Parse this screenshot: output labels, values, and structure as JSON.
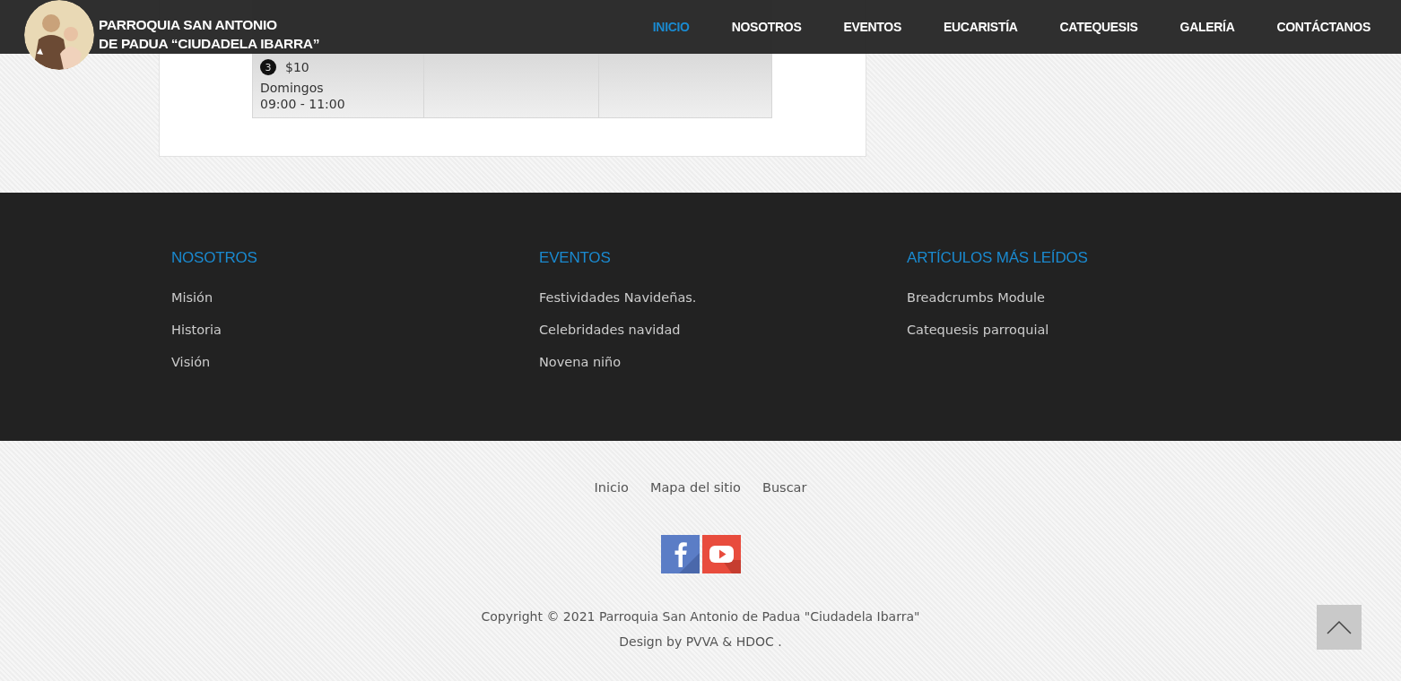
{
  "header": {
    "title_lines": [
      "PARROQUIA SAN ANTONIO",
      "DE PADUA “CIUDADELA IBARRA”"
    ],
    "nav": [
      {
        "label": "INICIO",
        "selected": true
      },
      {
        "label": "NOSOTROS",
        "selected": false
      },
      {
        "label": "EVENTOS",
        "selected": false
      },
      {
        "label": "EUCARISTÍA",
        "selected": false
      },
      {
        "label": "CATEQUESIS",
        "selected": false
      },
      {
        "label": "GALERÍA",
        "selected": false
      },
      {
        "label": "CONTÁCTANOS",
        "selected": false
      }
    ]
  },
  "schedule_card": {
    "badge": "3",
    "price": "$10",
    "day": "Domingos",
    "time": "09:00 - 11:00"
  },
  "footer_columns": [
    {
      "heading": "NOSOTROS",
      "links": [
        "Misión",
        "Historia",
        "Visión"
      ]
    },
    {
      "heading": "EVENTOS",
      "links": [
        "Festividades Navideñas.",
        "Celebridades navidad",
        "Novena niño"
      ]
    },
    {
      "heading": "ARTÍCULOS MÁS LEÍDOS",
      "links": [
        "Breadcrumbs Module",
        "Catequesis parroquial"
      ]
    }
  ],
  "bottom_links": [
    "Inicio",
    "Mapa del sitio",
    "Buscar"
  ],
  "social": [
    {
      "kind": "facebook"
    },
    {
      "kind": "youtube"
    }
  ],
  "copyright": "Copyright © 2021 Parroquia San Antonio de Padua \"Ciudadela Ibarra\"",
  "credits": "Design by PVVA & HDOC ."
}
